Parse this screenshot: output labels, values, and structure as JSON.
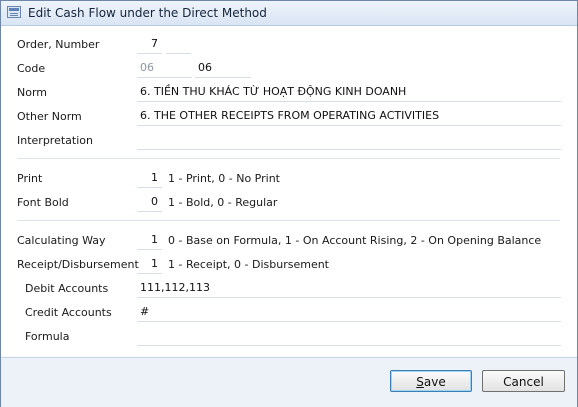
{
  "window": {
    "title": "Edit Cash Flow under the Direct Method"
  },
  "form": {
    "order_label": "Order, Number",
    "order_value": "7",
    "code_label": "Code",
    "code_parent": "06",
    "code_value": "06",
    "norm_label": "Norm",
    "norm_value": "6. TIỀN THU KHÁC TỪ HOẠT ĐỘNG KINH DOANH",
    "other_norm_label": "Other Norm",
    "other_norm_value": "6. THE OTHER RECEIPTS FROM OPERATING ACTIVITIES",
    "interpretation_label": "Interpretation",
    "interpretation_value": "",
    "print_label": "Print",
    "print_value": "1",
    "print_hint": "1 - Print, 0 - No Print",
    "bold_label": "Font Bold",
    "bold_value": "0",
    "bold_hint": "1 - Bold, 0 - Regular",
    "calc_label": "Calculating Way",
    "calc_value": "1",
    "calc_hint": "0 - Base on Formula, 1 - On Account Rising, 2 - On Opening Balance",
    "receipt_label": "Receipt/Disbursement",
    "receipt_value": "1",
    "receipt_hint": "1 - Receipt, 0 - Disbursement",
    "debit_label": "Debit Accounts",
    "debit_value": "111,112,113",
    "credit_label": "Credit Accounts",
    "credit_value": "#",
    "formula_label": "Formula",
    "formula_value": ""
  },
  "buttons": {
    "save_mnemonic": "S",
    "save_rest": "ave",
    "cancel_label": "Cancel"
  },
  "icons": {
    "title": "window-form-icon"
  }
}
